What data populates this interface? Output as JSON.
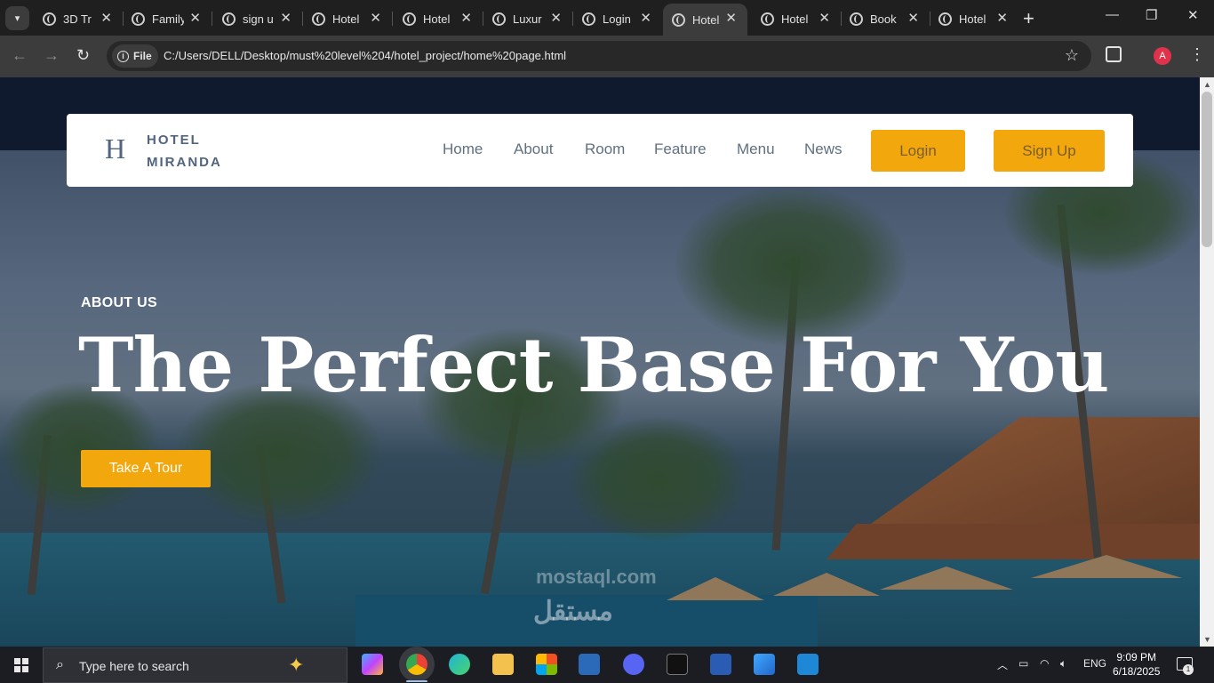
{
  "browser": {
    "tabs": [
      {
        "label": "3D Tr"
      },
      {
        "label": "Family"
      },
      {
        "label": "sign u"
      },
      {
        "label": "Hotel"
      },
      {
        "label": "Hotel"
      },
      {
        "label": "Luxur"
      },
      {
        "label": "Login"
      },
      {
        "label": "Hotel",
        "active": true
      },
      {
        "label": "Hotel"
      },
      {
        "label": "Book"
      },
      {
        "label": "Hotel"
      }
    ],
    "new_tab": "+",
    "window_controls": {
      "minimize": "—",
      "maximize": "❐",
      "close": "✕"
    },
    "nav": {
      "back": "←",
      "forward": "→",
      "reload": "↻"
    },
    "scheme_chip": "File",
    "url": "C:/Users/DELL/Desktop/must%20level%204/hotel_project/home%20page.html",
    "bookmark_icon": "☆",
    "profile_initial": "A",
    "menu_icon": "⋮"
  },
  "site": {
    "logo_letter": "H",
    "logo_line1": "HOTEL",
    "logo_line2": "MIRANDA",
    "nav": [
      "Home",
      "About",
      "Room",
      "Feature",
      "Menu",
      "News"
    ],
    "login_label": "Login",
    "signup_label": "Sign Up",
    "accent_color": "#f2a80d",
    "hero": {
      "eyebrow": "ABOUT US",
      "title": "The Perfect Base For You",
      "cta": "Take A Tour"
    }
  },
  "watermark": {
    "arabic": "مستقل",
    "latin": "mostaql.com"
  },
  "taskbar": {
    "search_placeholder": "Type here to search",
    "language": "ENG",
    "time": "9:09 PM",
    "date": "6/18/2025",
    "notification_count": "1"
  }
}
